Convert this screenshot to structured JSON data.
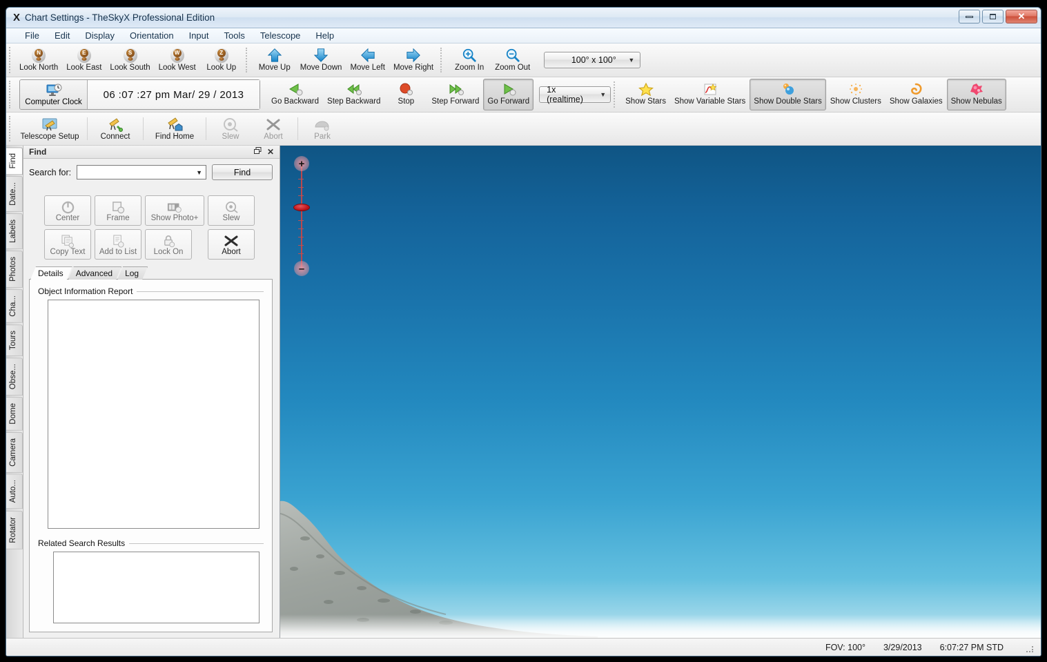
{
  "window": {
    "title": "Chart Settings - TheSkyX Professional Edition",
    "logo": "X",
    "buttons": {
      "minimize": "minimize-icon",
      "maximize": "maximize-icon",
      "close": "✕"
    }
  },
  "menubar": {
    "items": [
      "File",
      "Edit",
      "Display",
      "Orientation",
      "Input",
      "Tools",
      "Telescope",
      "Help"
    ]
  },
  "toolbar_row1": {
    "look": [
      {
        "label": "Look North",
        "letter": "N"
      },
      {
        "label": "Look East",
        "letter": "E"
      },
      {
        "label": "Look South",
        "letter": "S"
      },
      {
        "label": "Look West",
        "letter": "W"
      },
      {
        "label": "Look Up",
        "letter": "Z"
      }
    ],
    "move": [
      {
        "label": "Move Up",
        "icon": "arrow-up-icon"
      },
      {
        "label": "Move Down",
        "icon": "arrow-down-icon"
      },
      {
        "label": "Move Left",
        "icon": "arrow-left-icon"
      },
      {
        "label": "Move Right",
        "icon": "arrow-right-icon"
      }
    ],
    "zoom": [
      {
        "label": "Zoom In",
        "icon": "zoom-in-icon"
      },
      {
        "label": "Zoom Out",
        "icon": "zoom-out-icon"
      }
    ],
    "fov_select": {
      "value": "100° x 100°"
    }
  },
  "toolbar_row2": {
    "clock_button": "Computer Clock",
    "clock_readout": "06 :07 :27  pm   Mar/ 29 / 2013",
    "time_controls": [
      {
        "label": "Go Backward",
        "icon": "play-backward-icon",
        "pressed": false
      },
      {
        "label": "Step Backward",
        "icon": "step-backward-icon",
        "pressed": false
      },
      {
        "label": "Stop",
        "icon": "stop-icon",
        "pressed": false
      },
      {
        "label": "Step Forward",
        "icon": "step-forward-icon",
        "pressed": false
      },
      {
        "label": "Go Forward",
        "icon": "play-forward-icon",
        "pressed": true
      }
    ],
    "rate_select": {
      "value": "1x (realtime)"
    },
    "show_buttons": [
      {
        "label": "Show Stars",
        "icon": "star-icon",
        "pressed": false
      },
      {
        "label": "Show Variable Stars",
        "icon": "variable-star-icon",
        "pressed": false
      },
      {
        "label": "Show Double Stars",
        "icon": "double-star-icon",
        "pressed": true
      },
      {
        "label": "Show Clusters",
        "icon": "cluster-icon",
        "pressed": false
      },
      {
        "label": "Show Galaxies",
        "icon": "galaxy-icon",
        "pressed": false
      },
      {
        "label": "Show Nebulas",
        "icon": "nebula-icon",
        "pressed": true
      }
    ]
  },
  "toolbar_row3": {
    "buttons": [
      {
        "label": "Telescope Setup",
        "icon": "telescope-setup-icon",
        "disabled": false
      },
      {
        "label": "Connect",
        "icon": "telescope-connect-icon",
        "disabled": false
      },
      {
        "label": "Find Home",
        "icon": "telescope-home-icon",
        "disabled": false
      },
      {
        "label": "Slew",
        "icon": "slew-icon",
        "disabled": true
      },
      {
        "label": "Abort",
        "icon": "abort-icon",
        "disabled": true
      },
      {
        "label": "Park",
        "icon": "park-icon",
        "disabled": true
      }
    ]
  },
  "vtabs": {
    "items": [
      {
        "label": "Find",
        "active": true
      },
      {
        "label": "Date...",
        "active": false
      },
      {
        "label": "Labels",
        "active": false
      },
      {
        "label": "Photos",
        "active": false
      },
      {
        "label": "Cha...",
        "active": false
      },
      {
        "label": "Tours",
        "active": false
      },
      {
        "label": "Obse...",
        "active": false
      },
      {
        "label": "Dome",
        "active": false
      },
      {
        "label": "Camera",
        "active": false
      },
      {
        "label": "Auto...",
        "active": false
      },
      {
        "label": "Rotator",
        "active": false
      }
    ]
  },
  "find_panel": {
    "title": "Find",
    "undock_icon": "undock-icon",
    "close_icon": "close-icon",
    "search_label": "Search for:",
    "search_value": "",
    "search_placeholder": "",
    "find_button": "Find",
    "commands": [
      {
        "label": "Center",
        "icon": "center-icon",
        "enabled": false
      },
      {
        "label": "Frame",
        "icon": "frame-icon",
        "enabled": false
      },
      {
        "label": "Show Photo+",
        "icon": "photo-icon",
        "enabled": false
      },
      {
        "label": "Slew",
        "icon": "slew-icon",
        "enabled": false
      },
      {
        "label": "Copy Text",
        "icon": "copy-text-icon",
        "enabled": false
      },
      {
        "label": "Add to List",
        "icon": "add-to-list-icon",
        "enabled": false
      },
      {
        "label": "Lock On",
        "icon": "lock-icon",
        "enabled": false
      },
      {
        "label": "Abort",
        "icon": "abort-icon",
        "enabled": true
      }
    ],
    "tabs": [
      {
        "label": "Details",
        "active": true
      },
      {
        "label": "Advanced",
        "active": false
      },
      {
        "label": "Log",
        "active": false
      }
    ],
    "object_report_label": "Object Information Report",
    "object_report_text": "",
    "related_results_label": "Related Search Results",
    "related_results_text": ""
  },
  "sky_view": {
    "zoom_slider": {
      "plus": "+",
      "minus": "–",
      "position_pct": 48
    }
  },
  "statusbar": {
    "fov": "FOV: 100°",
    "date": "3/29/2013",
    "time": "6:07:27 PM STD"
  }
}
